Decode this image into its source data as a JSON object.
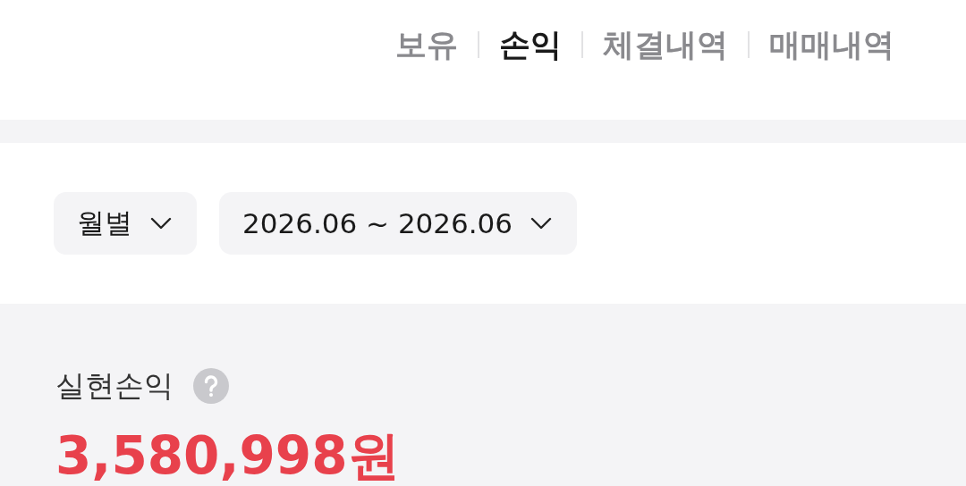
{
  "tabs": [
    {
      "label": "보유",
      "selected": false
    },
    {
      "label": "손익",
      "selected": true
    },
    {
      "label": "체결내역",
      "selected": false
    },
    {
      "label": "매매내역",
      "selected": false
    }
  ],
  "filters": [
    {
      "label": "월별"
    },
    {
      "label": "2026.06 ~ 2026.06"
    }
  ],
  "summary": {
    "label": "실현손익",
    "amount": "3,580,998원"
  }
}
